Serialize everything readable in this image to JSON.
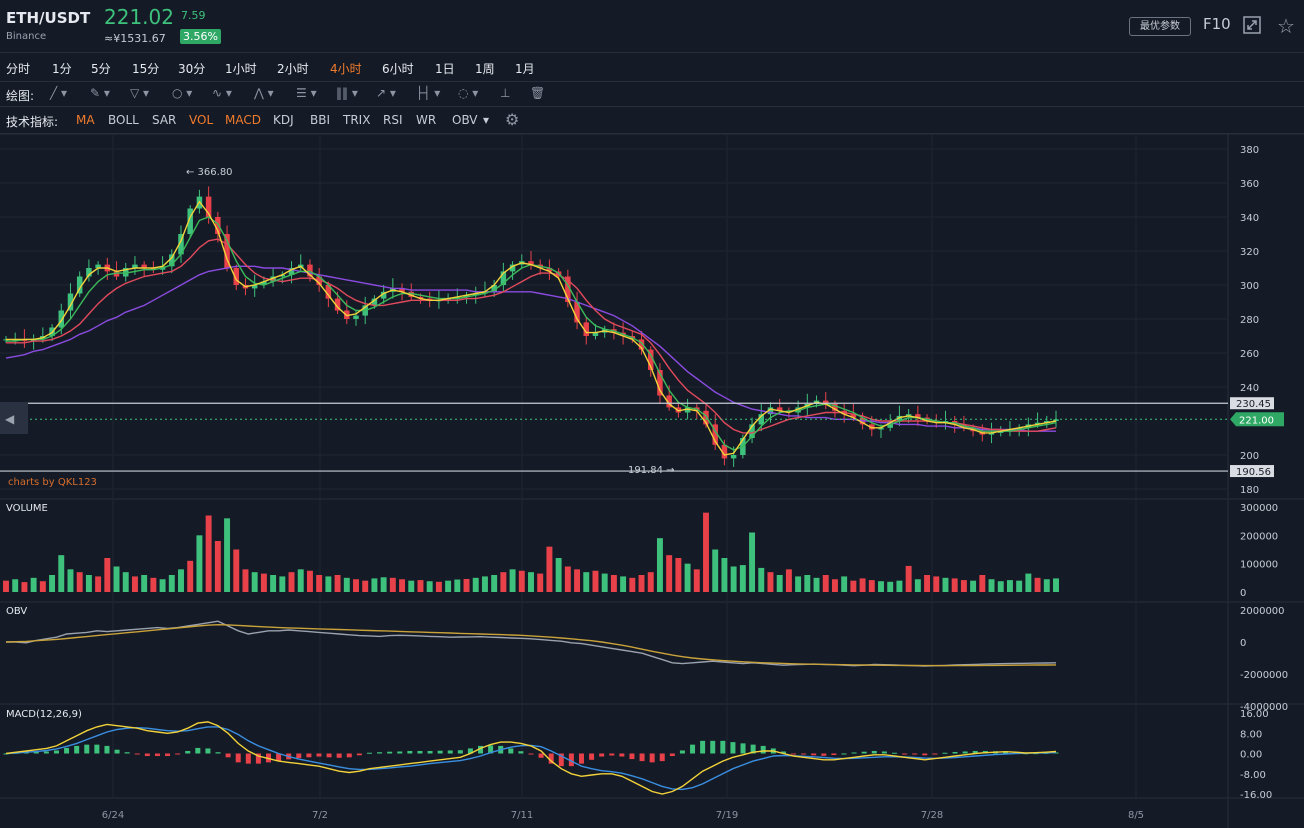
{
  "header": {
    "symbol": "ETH/USDT",
    "exchange": "Binance",
    "price": "221.02",
    "change": "7.59",
    "cny": "≈¥1531.67",
    "change_pct": "3.56%",
    "best_params": "最优参数",
    "f10": "F10"
  },
  "periods": {
    "items": [
      "分时",
      "1分",
      "5分",
      "15分",
      "30分",
      "1小时",
      "2小时",
      "4小时",
      "6小时",
      "1日",
      "1周",
      "1月"
    ],
    "active": "4小时"
  },
  "drawing": {
    "label": "绘图:",
    "tools": [
      "line-icon",
      "brush-icon",
      "triangle-icon",
      "circle-icon",
      "wave-icon",
      "pattern-icon",
      "fib-icon",
      "bars-icon",
      "arrow-icon",
      "range-icon",
      "comment-icon",
      "chart-settings-icon",
      "trash-icon"
    ]
  },
  "indicators": {
    "label": "技术指标:",
    "items": [
      "MA",
      "BOLL",
      "SAR",
      "VOL",
      "MACD",
      "KDJ",
      "BBI",
      "TRIX",
      "RSI",
      "WR",
      "OBV"
    ],
    "active": [
      "MA",
      "VOL",
      "MACD"
    ]
  },
  "watermark": "charts by QKL123",
  "colors": {
    "up": "#3dc17c",
    "down": "#e8414a",
    "ma_fast": "#f2d23a",
    "ma_mid": "#3cba5b",
    "ma_slow": "#e04a5c",
    "ma_long": "#8a4be0",
    "obv": "#9aa2af",
    "obv_ma": "#c9a23a",
    "macd_dif": "#f2d23a",
    "macd_dea": "#3a8ee0",
    "bg": "#151b26"
  },
  "chart_data": [
    {
      "type": "candlestick",
      "title": "",
      "price_axis": {
        "ticks": [
          "380",
          "360",
          "340",
          "320",
          "300",
          "280",
          "260",
          "240",
          "200",
          "180"
        ],
        "ylim": [
          180,
          385
        ]
      },
      "x_ticks": [
        "6/24",
        "7/2",
        "7/11",
        "7/19",
        "7/28",
        "8/5"
      ],
      "annotations": {
        "high": "366.80",
        "low": "191.84",
        "level_upper": "230.45",
        "level_lower": "190.56",
        "last": "221.00"
      },
      "closes": [
        268,
        268,
        267,
        268,
        270,
        275,
        285,
        295,
        305,
        310,
        312,
        308,
        305,
        310,
        312,
        310,
        309,
        311,
        318,
        330,
        345,
        352,
        340,
        330,
        310,
        300,
        298,
        300,
        302,
        305,
        306,
        310,
        312,
        305,
        300,
        292,
        285,
        280,
        282,
        288,
        292,
        296,
        298,
        296,
        293,
        292,
        291,
        291,
        292,
        293,
        294,
        295,
        296,
        300,
        308,
        312,
        314,
        312,
        310,
        308,
        305,
        290,
        278,
        270,
        272,
        274,
        272,
        270,
        268,
        262,
        250,
        235,
        228,
        225,
        228,
        226,
        218,
        206,
        198,
        200,
        210,
        218,
        224,
        228,
        226,
        225,
        228,
        230,
        232,
        230,
        226,
        224,
        222,
        218,
        215,
        216,
        220,
        223,
        224,
        222,
        220,
        219,
        220,
        218,
        216,
        214,
        212,
        213,
        214,
        215,
        216,
        218,
        219,
        220,
        221
      ],
      "ma_fast": [
        268,
        268,
        268,
        268,
        269,
        272,
        279,
        288,
        298,
        306,
        310,
        310,
        308,
        309,
        310,
        310,
        310,
        311,
        316,
        326,
        340,
        349,
        342,
        332,
        315,
        303,
        299,
        300,
        302,
        304,
        306,
        309,
        311,
        306,
        301,
        294,
        287,
        282,
        283,
        287,
        291,
        295,
        297,
        296,
        294,
        292,
        291,
        291,
        292,
        293,
        294,
        295,
        296,
        300,
        307,
        311,
        313,
        312,
        310,
        308,
        304,
        292,
        280,
        272,
        272,
        273,
        272,
        270,
        268,
        263,
        252,
        238,
        230,
        226,
        227,
        226,
        219,
        208,
        200,
        201,
        209,
        217,
        223,
        227,
        226,
        225,
        227,
        229,
        231,
        230,
        227,
        224,
        222,
        219,
        216,
        216,
        219,
        222,
        223,
        222,
        220,
        219,
        219,
        218,
        216,
        215,
        213,
        213,
        214,
        215,
        216,
        217,
        218,
        219,
        220
      ],
      "ma_mid": [
        267,
        267,
        268,
        268,
        268,
        270,
        274,
        280,
        288,
        296,
        302,
        306,
        307,
        307,
        308,
        309,
        309,
        310,
        312,
        318,
        328,
        338,
        340,
        336,
        326,
        314,
        305,
        301,
        300,
        302,
        304,
        306,
        308,
        308,
        305,
        300,
        294,
        288,
        285,
        285,
        287,
        290,
        293,
        295,
        295,
        294,
        293,
        292,
        292,
        292,
        293,
        294,
        295,
        297,
        301,
        306,
        310,
        312,
        311,
        310,
        307,
        300,
        290,
        281,
        276,
        274,
        273,
        271,
        269,
        266,
        259,
        248,
        238,
        231,
        228,
        227,
        223,
        214,
        206,
        203,
        205,
        211,
        217,
        222,
        225,
        226,
        226,
        228,
        229,
        230,
        229,
        227,
        225,
        222,
        219,
        217,
        218,
        220,
        222,
        222,
        221,
        220,
        219,
        219,
        217,
        216,
        214,
        214,
        214,
        214,
        215,
        216,
        217,
        218,
        219
      ],
      "ma_slow": [
        266,
        266,
        266,
        267,
        267,
        268,
        270,
        273,
        277,
        283,
        289,
        294,
        298,
        301,
        303,
        305,
        306,
        307,
        308,
        311,
        316,
        322,
        326,
        327,
        324,
        318,
        312,
        307,
        304,
        303,
        302,
        303,
        304,
        304,
        303,
        301,
        298,
        294,
        291,
        289,
        288,
        288,
        289,
        290,
        291,
        291,
        291,
        291,
        291,
        291,
        292,
        292,
        293,
        294,
        296,
        299,
        302,
        305,
        307,
        307,
        306,
        303,
        298,
        291,
        285,
        280,
        277,
        275,
        273,
        271,
        266,
        259,
        251,
        244,
        238,
        234,
        230,
        225,
        219,
        215,
        213,
        213,
        215,
        217,
        219,
        221,
        222,
        223,
        224,
        225,
        225,
        225,
        224,
        223,
        221,
        220,
        220,
        220,
        220,
        220,
        220,
        220,
        219,
        219,
        218,
        217,
        216,
        215,
        215,
        214,
        214,
        214,
        214,
        215,
        216
      ],
      "ma_long": [
        257,
        258,
        259,
        261,
        262,
        264,
        266,
        268,
        271,
        273,
        276,
        279,
        281,
        284,
        286,
        288,
        291,
        294,
        297,
        300,
        303,
        306,
        308,
        309,
        310,
        311,
        311,
        311,
        310,
        310,
        310,
        309,
        308,
        307,
        306,
        305,
        304,
        303,
        302,
        301,
        300,
        299,
        298,
        298,
        297,
        297,
        297,
        297,
        297,
        297,
        297,
        296,
        296,
        296,
        296,
        296,
        296,
        296,
        295,
        294,
        293,
        292,
        290,
        288,
        286,
        284,
        282,
        279,
        276,
        272,
        268,
        264,
        259,
        254,
        249,
        245,
        241,
        237,
        234,
        231,
        229,
        227,
        226,
        225,
        224,
        223,
        223,
        222,
        222,
        222,
        221,
        221,
        221,
        220,
        220,
        219,
        219,
        218,
        218,
        218,
        217,
        217,
        217,
        216,
        216,
        216,
        215,
        215,
        215,
        215,
        215,
        214,
        214,
        214,
        214
      ]
    },
    {
      "type": "bar",
      "name": "VOLUME",
      "title": "VOLUME",
      "y_ticks": [
        "300000",
        "200000",
        "100000",
        "0"
      ],
      "ylim": [
        0,
        300000
      ],
      "values": [
        40000,
        45000,
        35000,
        50000,
        38000,
        60000,
        130000,
        80000,
        70000,
        60000,
        55000,
        120000,
        90000,
        70000,
        55000,
        60000,
        50000,
        45000,
        60000,
        80000,
        110000,
        200000,
        270000,
        180000,
        260000,
        150000,
        80000,
        70000,
        65000,
        60000,
        55000,
        70000,
        80000,
        75000,
        60000,
        55000,
        60000,
        50000,
        45000,
        40000,
        48000,
        52000,
        50000,
        45000,
        40000,
        42000,
        38000,
        36000,
        40000,
        44000,
        46000,
        50000,
        55000,
        60000,
        70000,
        80000,
        75000,
        70000,
        65000,
        160000,
        120000,
        90000,
        80000,
        70000,
        75000,
        65000,
        60000,
        55000,
        50000,
        60000,
        70000,
        190000,
        130000,
        120000,
        100000,
        80000,
        280000,
        150000,
        120000,
        90000,
        95000,
        210000,
        85000,
        70000,
        60000,
        80000,
        55000,
        60000,
        50000,
        60000,
        45000,
        55000,
        40000,
        48000,
        42000,
        38000,
        36000,
        40000,
        92000,
        45000,
        60000,
        55000,
        50000,
        48000,
        42000,
        40000,
        60000,
        45000,
        38000,
        42000,
        40000,
        65000,
        50000,
        45000,
        48000
      ],
      "up": [
        0,
        1,
        0,
        1,
        0,
        1,
        1,
        1,
        0,
        1,
        0,
        0,
        1,
        1,
        0,
        1,
        0,
        1,
        1,
        1,
        0,
        1,
        0,
        0,
        1,
        0,
        0,
        1,
        0,
        1,
        1,
        0,
        1,
        0,
        0,
        1,
        0,
        1,
        0,
        0,
        1,
        1,
        0,
        0,
        1,
        0,
        1,
        0,
        1,
        1,
        0,
        1,
        1,
        1,
        0,
        1,
        0,
        1,
        0,
        0,
        1,
        0,
        0,
        1,
        0,
        1,
        0,
        1,
        0,
        0,
        0,
        1,
        0,
        0,
        1,
        0,
        0,
        1,
        1,
        1,
        1,
        1,
        1,
        0,
        1,
        0,
        1,
        1,
        1,
        0,
        0,
        1,
        0,
        0,
        0,
        1,
        1,
        1,
        0,
        1,
        0,
        0,
        1,
        0,
        0,
        1,
        0,
        1,
        1,
        1,
        1,
        1,
        0,
        1,
        1
      ]
    },
    {
      "type": "line",
      "name": "OBV",
      "title": "OBV",
      "y_ticks": [
        "2000000",
        "0",
        "-2000000",
        "-4000000"
      ],
      "ylim": [
        -4000000,
        2000000
      ],
      "obv": [
        0,
        0,
        -50000,
        100000,
        200000,
        300000,
        500000,
        550000,
        600000,
        700000,
        650000,
        700000,
        750000,
        800000,
        850000,
        900000,
        850000,
        900000,
        1000000,
        1100000,
        1200000,
        1300000,
        1000000,
        700000,
        500000,
        600000,
        700000,
        700000,
        750000,
        700000,
        650000,
        600000,
        550000,
        500000,
        450000,
        400000,
        380000,
        350000,
        400000,
        420000,
        400000,
        380000,
        350000,
        330000,
        300000,
        310000,
        320000,
        330000,
        300000,
        280000,
        250000,
        230000,
        200000,
        150000,
        100000,
        50000,
        -50000,
        -100000,
        -200000,
        -300000,
        -400000,
        -500000,
        -600000,
        -700000,
        -900000,
        -1100000,
        -1300000,
        -1350000,
        -1300000,
        -1250000,
        -1200000,
        -1250000,
        -1300000,
        -1350000,
        -1300000,
        -1350000,
        -1400000,
        -1450000,
        -1420000,
        -1400000,
        -1380000,
        -1400000,
        -1420000,
        -1450000,
        -1480000,
        -1450000,
        -1400000,
        -1420000,
        -1440000,
        -1460000,
        -1480000,
        -1500000,
        -1480000,
        -1460000,
        -1440000,
        -1420000,
        -1400000,
        -1380000,
        -1360000,
        -1350000,
        -1340000,
        -1330000,
        -1320000,
        -1310000,
        -1300000
      ],
      "obv_ma": [
        0,
        20000,
        40000,
        80000,
        120000,
        160000,
        220000,
        280000,
        340000,
        400000,
        460000,
        520000,
        580000,
        640000,
        700000,
        760000,
        820000,
        880000,
        940000,
        1000000,
        1050000,
        1080000,
        1070000,
        1040000,
        1000000,
        960000,
        930000,
        900000,
        880000,
        860000,
        840000,
        820000,
        800000,
        780000,
        760000,
        740000,
        720000,
        700000,
        680000,
        660000,
        640000,
        620000,
        600000,
        580000,
        560000,
        540000,
        520000,
        500000,
        480000,
        460000,
        440000,
        420000,
        380000,
        340000,
        300000,
        250000,
        200000,
        140000,
        80000,
        0,
        -100000,
        -200000,
        -320000,
        -450000,
        -580000,
        -700000,
        -820000,
        -920000,
        -1000000,
        -1060000,
        -1110000,
        -1160000,
        -1200000,
        -1240000,
        -1270000,
        -1300000,
        -1320000,
        -1340000,
        -1360000,
        -1380000,
        -1390000,
        -1400000,
        -1410000,
        -1420000,
        -1430000,
        -1440000,
        -1450000,
        -1455000,
        -1460000,
        -1465000,
        -1470000,
        -1475000,
        -1478000,
        -1480000,
        -1478000,
        -1475000,
        -1470000,
        -1465000,
        -1460000,
        -1455000,
        -1450000,
        -1445000,
        -1440000,
        -1435000,
        -1430000
      ]
    },
    {
      "type": "line",
      "name": "MACD(12,26,9)",
      "title": "MACD(12,26,9)",
      "y_ticks": [
        "16.00",
        "8.00",
        "0.00",
        "-8.00",
        "-16.00"
      ],
      "ylim": [
        -18,
        18
      ],
      "dif": [
        0,
        0.5,
        1,
        1.5,
        2,
        3,
        5,
        7,
        9,
        10.5,
        11.5,
        11,
        10.5,
        10,
        9,
        8.5,
        8,
        8.5,
        10,
        12,
        12.5,
        11,
        8,
        4,
        1,
        -1,
        -2,
        -3,
        -3.5,
        -4,
        -4.5,
        -5,
        -6,
        -7,
        -7.5,
        -7,
        -6,
        -5.5,
        -5,
        -4.5,
        -4,
        -3.5,
        -3,
        -2.5,
        -2,
        -1.5,
        0,
        2,
        3.5,
        4.5,
        4.5,
        4,
        3,
        1,
        -3,
        -6,
        -8,
        -9,
        -8.5,
        -8,
        -8,
        -9,
        -11,
        -13,
        -15,
        -16,
        -15,
        -13,
        -10,
        -7,
        -5,
        -3,
        -1.5,
        -0.5,
        0.5,
        1,
        1,
        0,
        -1,
        -1.5,
        -2,
        -2.5,
        -2.5,
        -2,
        -1.5,
        -1,
        -0.5,
        -0.5,
        -1,
        -1.5,
        -2,
        -2.5,
        -2,
        -1.5,
        -1,
        -0.5,
        0,
        0.3,
        0.5,
        0.7,
        0.5,
        0.2,
        0.3,
        0.5,
        0.8
      ],
      "dea": [
        0,
        0.2,
        0.5,
        0.8,
        1.2,
        1.8,
        2.8,
        4,
        5.5,
        7,
        8.5,
        9.5,
        10,
        10.2,
        10,
        9.5,
        9,
        8.8,
        9,
        9.8,
        10.5,
        10.5,
        9.5,
        7.5,
        5,
        3,
        1.5,
        0,
        -1.2,
        -2.2,
        -3,
        -3.8,
        -4.5,
        -5.3,
        -6,
        -6.3,
        -6.3,
        -6,
        -5.7,
        -5.3,
        -5,
        -4.5,
        -4,
        -3.6,
        -3.2,
        -2.8,
        -2,
        -1,
        0.3,
        1.5,
        2.5,
        3.1,
        3.2,
        2.7,
        1,
        -1,
        -3,
        -5,
        -6,
        -6.8,
        -7.2,
        -7.8,
        -8.8,
        -10,
        -11.5,
        -13,
        -14,
        -14.2,
        -13.5,
        -12,
        -10,
        -8,
        -6,
        -4.5,
        -3,
        -2,
        -1,
        -0.8,
        -0.9,
        -1.1,
        -1.3,
        -1.6,
        -1.9,
        -2,
        -1.9,
        -1.7,
        -1.5,
        -1.3,
        -1.3,
        -1.4,
        -1.6,
        -1.8,
        -1.9,
        -1.8,
        -1.6,
        -1.3,
        -1,
        -0.7,
        -0.4,
        -0.2,
        0,
        0.1,
        0.15,
        0.25,
        0.4
      ]
    }
  ],
  "x_ticks": [
    "6/24",
    "7/2",
    "7/11",
    "7/19",
    "7/28",
    "8/5"
  ]
}
